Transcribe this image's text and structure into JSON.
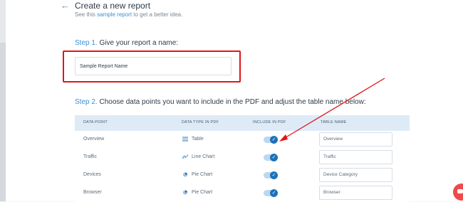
{
  "header": {
    "back_icon": "arrow-left-icon",
    "title": "Create a new report",
    "subtitle_prefix": "See this ",
    "subtitle_link": "sample report",
    "subtitle_suffix": " to get a better idea."
  },
  "step1": {
    "num": "Step 1.",
    "text": " Give your report a name:",
    "input_value": "Sample Report Name"
  },
  "step2": {
    "num": "Step 2.",
    "text": " Choose data points you want to include in the PDF and adjust the table name below:"
  },
  "table": {
    "headers": [
      "DATA POINT",
      "DATA TYPE IN PDF",
      "INCLUDE IN PDF",
      "TABLE NAME"
    ],
    "rows": [
      {
        "point": "Overview",
        "type": "Table",
        "icon": "table-icon",
        "included": true,
        "table_name": "Overview"
      },
      {
        "point": "Traffic",
        "type": "Line Chart",
        "icon": "line-chart-icon",
        "included": true,
        "table_name": "Traffic"
      },
      {
        "point": "Devices",
        "type": "Pie Chart",
        "icon": "pie-chart-icon",
        "included": true,
        "table_name": "Device Category"
      },
      {
        "point": "Browser",
        "type": "Pie Chart",
        "icon": "pie-chart-icon",
        "included": true,
        "table_name": "Browser"
      }
    ]
  },
  "colors": {
    "accent": "#3c8fd6",
    "annotation": "#e0141c",
    "toggle_on": "#1d72b8",
    "chat": "#ef4a4a"
  },
  "chat_icon": "chat-bubble-icon"
}
